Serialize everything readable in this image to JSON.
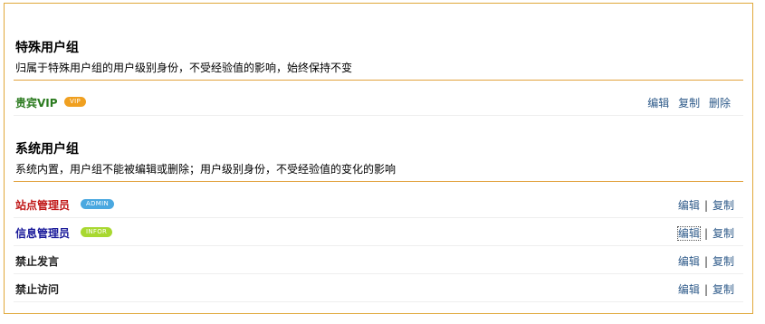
{
  "special": {
    "title": "特殊用户组",
    "desc": "归属于特殊用户组的用户级别身份，不受经验值的影响，始终保持不变",
    "rows": [
      {
        "name": "贵宾VIP",
        "badge": "VIP",
        "edit": "编辑",
        "copy": "复制",
        "delete": "删除"
      }
    ]
  },
  "system": {
    "title": "系统用户组",
    "desc": "系统内置，用户组不能被编辑或删除；用户级别身份，不受经验值的变化的影响",
    "rows": [
      {
        "name": "站点管理员",
        "badge": "ADMIN",
        "edit": "编辑",
        "sep": "|",
        "copy": "复制"
      },
      {
        "name": "信息管理员",
        "badge": "INFOR",
        "edit": "编辑",
        "sep": "|",
        "copy": "复制"
      },
      {
        "name": "禁止发言",
        "edit": "编辑",
        "sep": "|",
        "copy": "复制"
      },
      {
        "name": "禁止访问",
        "edit": "编辑",
        "sep": "|",
        "copy": "复制"
      }
    ]
  },
  "colors": {
    "vip_name": "#2a7a1e",
    "admin_name": "#c01818",
    "infor_name": "#1a1a9a",
    "plain_name": "#222222",
    "vip_badge": "#f0a020",
    "admin_badge": "#4aa8e0",
    "infor_badge": "#a8d830",
    "link": "#2f5b8a",
    "border": "#e0a83a"
  }
}
